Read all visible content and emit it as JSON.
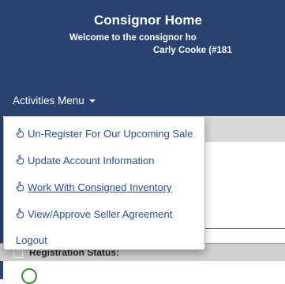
{
  "header": {
    "title": "Consignor Home",
    "welcome": "Welcome to the consignor ho",
    "user": "Carly Cooke (#181"
  },
  "nav": {
    "menu_label": "Activities Menu"
  },
  "dropdown": {
    "items": [
      {
        "label": "Un-Register For Our Upcoming Sale",
        "icon": "hand-pointer-icon"
      },
      {
        "label": "Update Account Information",
        "icon": "hand-pointer-icon"
      },
      {
        "label": "Work With Consigned Inventory",
        "icon": "hand-pointer-icon"
      },
      {
        "label": "View/Approve Seller Agreement",
        "icon": "hand-pointer-icon"
      },
      {
        "label": "Logout"
      }
    ]
  },
  "status": {
    "label": "Registration Status:"
  },
  "colors": {
    "header_bg": "#2a4271",
    "link": "#2a4d8f"
  }
}
